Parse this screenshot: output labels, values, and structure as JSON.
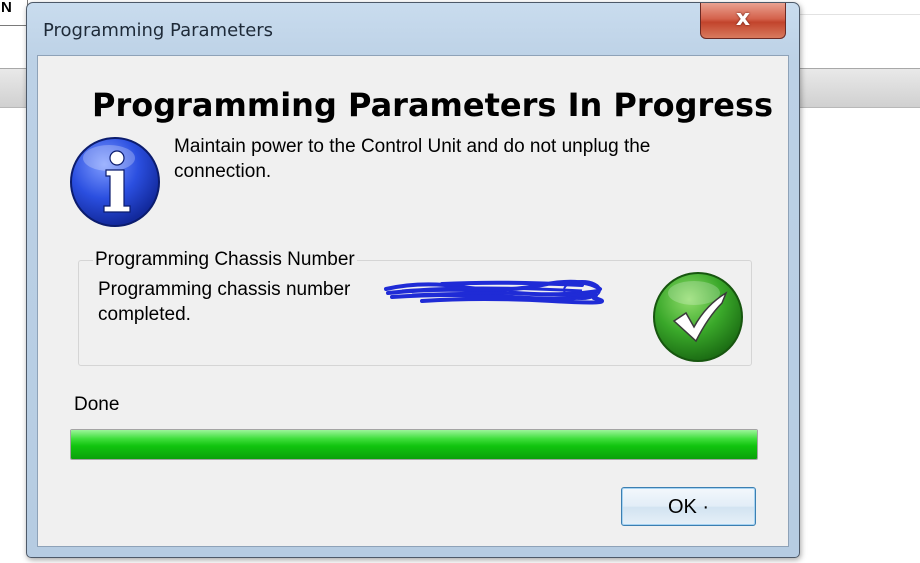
{
  "background": {
    "corner_text": "N"
  },
  "window": {
    "title": "Programming Parameters",
    "close_glyph": "x"
  },
  "heading": "Programming Parameters In Progress",
  "message": "Maintain power to the Control Unit and do not unplug the connection.",
  "group": {
    "label": "Programming Chassis Number",
    "text": "Programming chassis number",
    "text_after": "completed."
  },
  "status": {
    "label": "Done",
    "progress_fraction": 1.0
  },
  "ok_button": {
    "label": "OK ·"
  },
  "icons": {
    "info": "info-icon",
    "success": "checkmark-icon",
    "redaction": "redaction-scribble"
  },
  "colors": {
    "progress_green": "#11c40f",
    "info_blue": "#1c3fd0",
    "check_green": "#2f9a22",
    "redaction_blue": "#1f2bd6",
    "close_red": "#c2442c"
  }
}
